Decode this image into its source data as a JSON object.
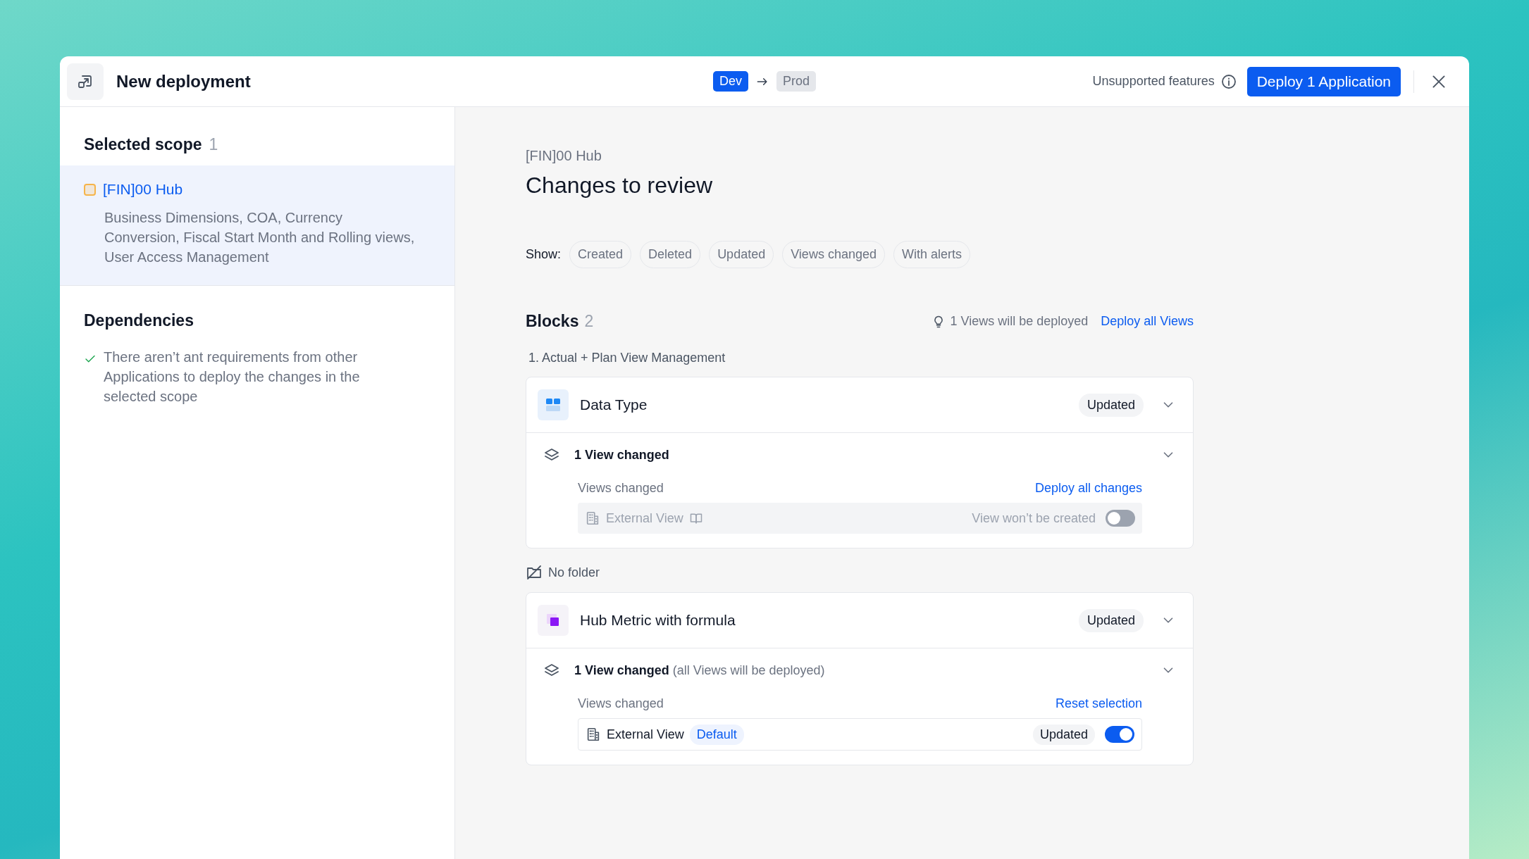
{
  "window": {
    "title": "New deployment",
    "source_env": "Dev",
    "target_env": "Prod",
    "unsupported_label": "Unsupported features",
    "deploy_button": "Deploy 1 Application"
  },
  "sidebar": {
    "scope_title": "Selected scope",
    "scope_count": "1",
    "scope_items": [
      {
        "name": "[FIN]00 Hub",
        "description": "Business Dimensions, COA, Currency Conversion, Fiscal Start Month and Rolling views, User Access Management",
        "selected": true,
        "color": "#f6b44a"
      }
    ],
    "dependencies_title": "Dependencies",
    "dependencies": [
      {
        "text": "There aren’t ant requirements from other Applications to deploy the changes in the selected scope",
        "satisfied": true
      }
    ]
  },
  "main": {
    "app_name": "[FIN]00 Hub",
    "title": "Changes to review",
    "filter_label": "Show:",
    "filters": [
      {
        "label": "Created",
        "selected": false
      },
      {
        "label": "Deleted",
        "selected": false
      },
      {
        "label": "Updated",
        "selected": false
      },
      {
        "label": "Views changed",
        "selected": false
      },
      {
        "label": "With alerts",
        "selected": false
      }
    ],
    "blocks_title": "Blocks",
    "blocks_count": "2",
    "views_note": "1 Views will be deployed",
    "deploy_all_views": "Deploy all Views",
    "groups": [
      {
        "kind": "folder",
        "title": "1. Actual + Plan View Management",
        "blocks": [
          {
            "name": "Data Type",
            "kind": "data-type",
            "status": "Updated",
            "expanded": true,
            "views_summary": "1 View changed",
            "views_label": "Views changed",
            "action": "Deploy all changes",
            "views": [
              {
                "name": "External View",
                "docs_icon": true,
                "status": "View won’t be created",
                "on": false
              }
            ]
          }
        ]
      },
      {
        "kind": "no-folder",
        "title": "No folder",
        "blocks": [
          {
            "name": "Hub Metric with formula",
            "kind": "metric",
            "status": "Updated",
            "expanded": true,
            "views_summary": "1 View changed",
            "views_note": "(all Views will be deployed)",
            "views_label": "Views changed",
            "action": "Reset selection",
            "views": [
              {
                "name": "External View",
                "tag": "Default",
                "status": "Updated",
                "on": true
              }
            ]
          }
        ]
      }
    ]
  }
}
